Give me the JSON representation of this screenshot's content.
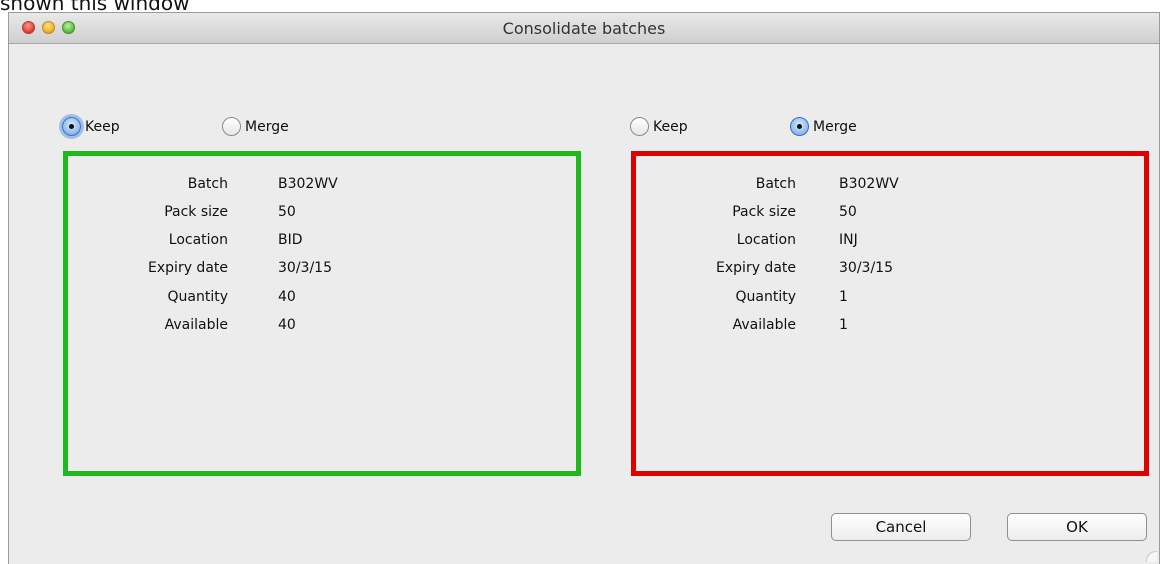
{
  "doc_caption": "shown this window",
  "window": {
    "title": "Consolidate batches"
  },
  "left": {
    "radio_keep": "Keep",
    "radio_merge": "Merge",
    "selected": "Keep",
    "border_color": "#1fb81f",
    "fields": [
      {
        "label": "Batch",
        "value": "B302WV"
      },
      {
        "label": "Pack size",
        "value": "50"
      },
      {
        "label": "Location",
        "value": "BID"
      },
      {
        "label": "Expiry date",
        "value": "30/3/15"
      },
      {
        "label": "Quantity",
        "value": "40"
      },
      {
        "label": "Available",
        "value": "40"
      }
    ]
  },
  "right": {
    "radio_keep": "Keep",
    "radio_merge": "Merge",
    "selected": "Merge",
    "border_color": "#e00000",
    "fields": [
      {
        "label": "Batch",
        "value": "B302WV"
      },
      {
        "label": "Pack size",
        "value": "50"
      },
      {
        "label": "Location",
        "value": "INJ"
      },
      {
        "label": "Expiry date",
        "value": "30/3/15"
      },
      {
        "label": "Quantity",
        "value": "1"
      },
      {
        "label": "Available",
        "value": "1"
      }
    ]
  },
  "buttons": {
    "cancel": "Cancel",
    "ok": "OK"
  }
}
